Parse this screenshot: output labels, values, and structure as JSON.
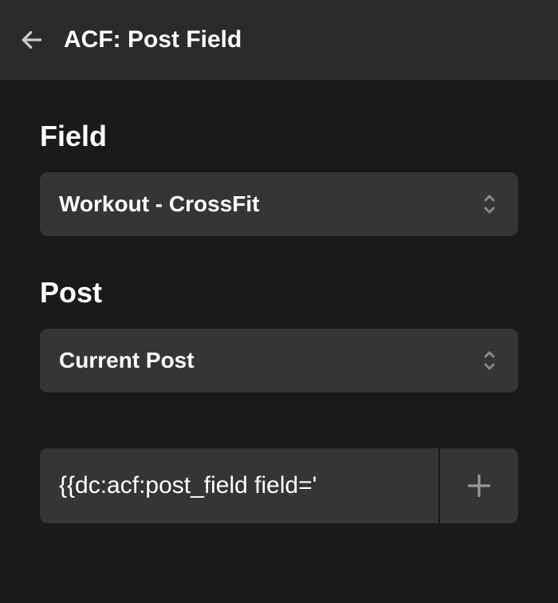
{
  "header": {
    "title": "ACF: Post Field"
  },
  "fields": {
    "field_label": "Field",
    "field_value": "Workout - CrossFit",
    "post_label": "Post",
    "post_value": "Current Post"
  },
  "code": {
    "value": "{{dc:acf:post_field field='"
  }
}
